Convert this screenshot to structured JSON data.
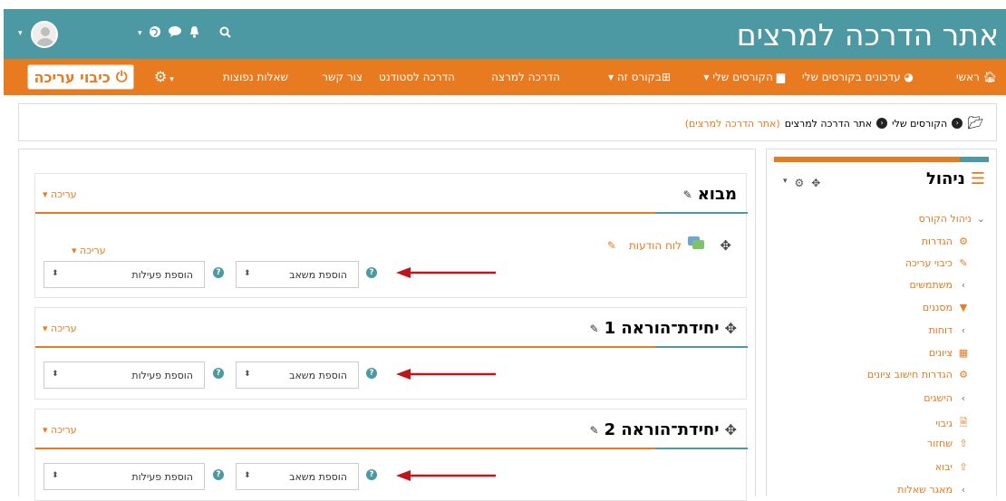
{
  "header": {
    "site_title": "אתר הדרכה למרצים"
  },
  "nav": {
    "home": "ראשי",
    "course_updates": "עדכונים בקורסים שלי",
    "my_courses": "הקורסים שלי",
    "this_course": "בקורס זה",
    "lecturer_guide": "הדרכה למרצה",
    "student_guide": "הדרכה לסטודנט",
    "contact": "צור קשר",
    "faq": "שאלות נפוצות",
    "edit_off": "כיבוי עריכה"
  },
  "breadcrumb": {
    "items": [
      "הקורסים שלי",
      "אתר הדרכה למרצים",
      "(אתר הדרכה למרצים)"
    ]
  },
  "common": {
    "edit": "עריכה",
    "add_resource": "הוספת משאב",
    "add_activity": "הוספת פעילות"
  },
  "sections": [
    {
      "title": "מבוא",
      "forum": "לוח הודעות",
      "item_edit": "עריכה"
    },
    {
      "title": "יחידת־הוראה 1"
    },
    {
      "title": "יחידת־הוראה 2"
    }
  ],
  "sidebar": {
    "title": "ניהול",
    "course_admin": "ניהול הקורס",
    "items": [
      {
        "label": "הגדרות",
        "icon": "gear-icon"
      },
      {
        "label": "כיבוי עריכה",
        "icon": "pencil-icon"
      },
      {
        "label": "משתמשים",
        "icon": "chevron-left-icon"
      },
      {
        "label": "מסננים",
        "icon": "filter-icon"
      },
      {
        "label": "דוחות",
        "icon": "chevron-left-icon"
      },
      {
        "label": "ציונים",
        "icon": "table-icon"
      },
      {
        "label": "הגדרות חישוב ציונים",
        "icon": "gear-icon"
      },
      {
        "label": "הישגים",
        "icon": "chevron-left-icon"
      },
      {
        "label": "גיבוי",
        "icon": "file-icon"
      },
      {
        "label": "שחזור",
        "icon": "upload-icon"
      },
      {
        "label": "יבוא",
        "icon": "upload-icon"
      },
      {
        "label": "מאגר שאלות",
        "icon": "chevron-left-icon"
      }
    ]
  },
  "colors": {
    "teal": "#4c98a3",
    "orange": "#e87a1f",
    "arrow": "#c0151b"
  }
}
